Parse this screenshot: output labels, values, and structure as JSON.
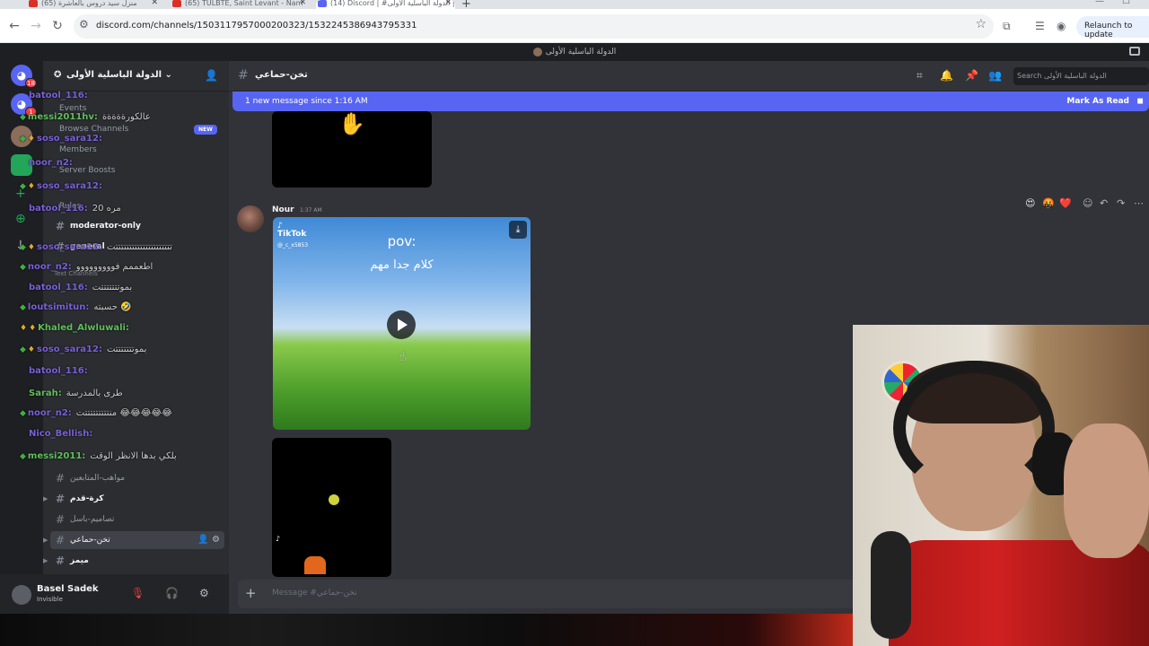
{
  "browser": {
    "tabs": [
      {
        "label": "(65) منزل سيد دروس بالعاشرة"
      },
      {
        "label": "(65) TULBTE, Saint Levant - Nam"
      },
      {
        "label": "(14) Discord | #تخن-حماعي | الدولة الباسلية الأولى"
      }
    ],
    "url": "discord.com/channels/1503117957000200323/1532245386943795331",
    "relaunch_label": "Relaunch to update"
  },
  "discord": {
    "window_title": "الدولة الباسلية الأولى",
    "rail": {
      "home_badge": "18",
      "server_badge": "1"
    },
    "server": {
      "name": "الدولة الباسلية الأولى",
      "menu": [
        "Events",
        "Browse Channels",
        "Members",
        "Server Boosts",
        "Rules"
      ],
      "new_badge": "NEW",
      "category": "Text Channels"
    },
    "channels": [
      {
        "label": "moderator-only"
      },
      {
        "label": "general"
      },
      {
        "label": "مواهب-المتابعين"
      },
      {
        "label": "كرة-قدم"
      },
      {
        "label": "تصاميم-باسل"
      },
      {
        "label": "تخن-حماعي"
      },
      {
        "label": "ميمز"
      }
    ],
    "user": {
      "name": "Basel Sadek",
      "status": "Invisible"
    },
    "channel_header": {
      "name": "تخن-حماعي",
      "search_placeholder": "Search الدولة الباسلية الأولى"
    },
    "new_message_bar": {
      "text": "1 new message since 1:16 AM",
      "action": "Mark As Read"
    },
    "message": {
      "author": "Nour",
      "time": "1:37 AM",
      "video": {
        "brand": "TikTok",
        "handle": "@_c_x5853",
        "pov": "pov:",
        "caption": "كلام جدا مهم"
      },
      "reactions": [
        "😍",
        "🤬",
        "❤️"
      ]
    },
    "composer_placeholder": "Message #تخن-حماعي"
  },
  "stream_chat": [
    {
      "user": "batool_116:",
      "msg": "",
      "color": "purple"
    },
    {
      "user": "messi2011hv:",
      "msg": "عالكورةةةةة",
      "color": "green"
    },
    {
      "user": "soso_sara12:",
      "msg": "",
      "color": "purple"
    },
    {
      "user": "noor_n2:",
      "msg": "",
      "color": "purple"
    },
    {
      "user": "soso_sara12:",
      "msg": "",
      "color": "purple"
    },
    {
      "user": "batool_116:",
      "msg": "مره 20",
      "color": "purple"
    },
    {
      "user": "soso_sara12:",
      "msg": "تتتتتتتتتتتتتتتتتتتتتت",
      "color": "purple"
    },
    {
      "user": "noor_n2:",
      "msg": "اطعممم فووووووووو",
      "color": "purple"
    },
    {
      "user": "batool_116:",
      "msg": "بموتتتتتتتت",
      "color": "purple"
    },
    {
      "user": "loutsimitun:",
      "msg": "حسبته 🤣",
      "color": "purple"
    },
    {
      "user": "Khaled_Alwluwali:",
      "msg": "",
      "color": "green"
    },
    {
      "user": "soso_sara12:",
      "msg": "بموتتتتتتتت",
      "color": "purple"
    },
    {
      "user": "batool_116:",
      "msg": "",
      "color": "purple"
    },
    {
      "user": "Sarah:",
      "msg": "طرى بالمدرسة",
      "color": "green"
    },
    {
      "user": "noor_n2:",
      "msg": "منتتتتتتتتتت 😂😂😂😂😂",
      "color": "purple"
    },
    {
      "user": "Nico_Bellish:",
      "msg": "",
      "color": "purple"
    },
    {
      "user": "messi2011:",
      "msg": "بلكي بدها الانظر الوقت",
      "color": "green"
    }
  ],
  "colors": {
    "blurple": "#5865f2",
    "sidebar": "#2b2d31",
    "chat": "#313338",
    "rail": "#1e1f22",
    "red": "#f23f43"
  }
}
